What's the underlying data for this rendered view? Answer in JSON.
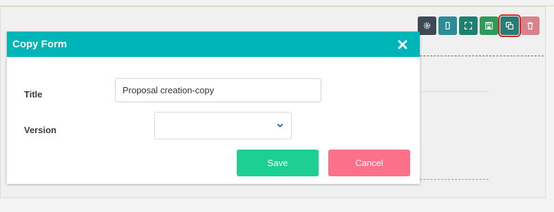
{
  "toolbar": {
    "icons": [
      "gear-icon",
      "mobile-icon",
      "expand-icon",
      "save-icon",
      "copy-icon",
      "trash-icon"
    ]
  },
  "modal": {
    "title": "Copy Form",
    "close_icon": "close-icon",
    "fields": {
      "title_label": "Title",
      "title_value": "Proposal creation-copy",
      "version_label": "Version",
      "version_value": ""
    },
    "buttons": {
      "save_label": "Save",
      "cancel_label": "Cancel"
    }
  },
  "colors": {
    "header": "#00b5b8",
    "save": "#1ecf94",
    "cancel": "#fc7189",
    "highlight": "#e02020"
  }
}
